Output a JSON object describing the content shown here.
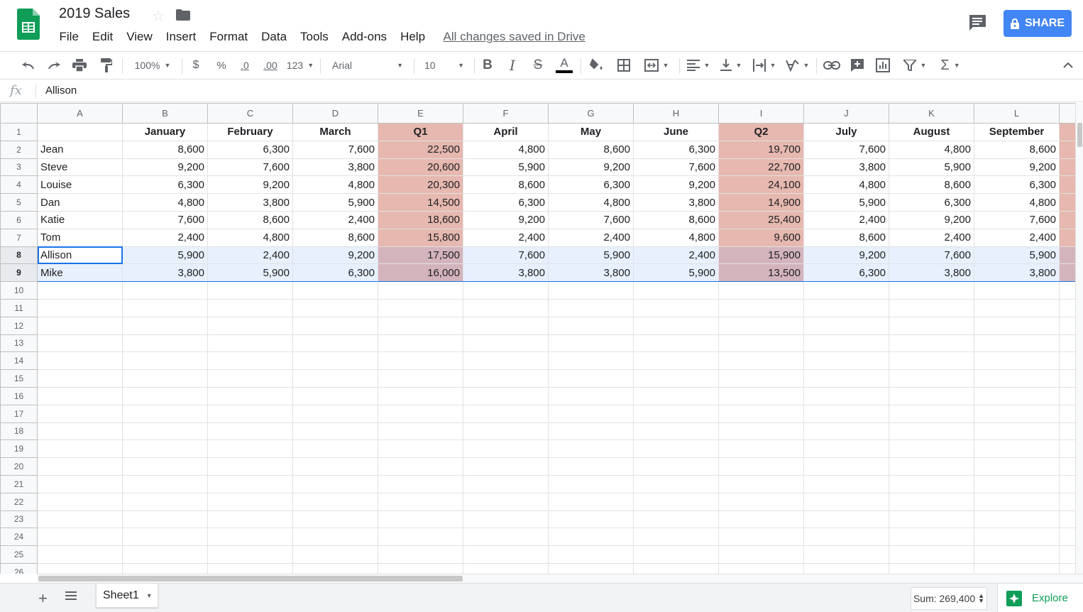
{
  "doc": {
    "title": "2019 Sales",
    "saved_status": "All changes saved in Drive",
    "share_label": "SHARE"
  },
  "menu": [
    "File",
    "Edit",
    "View",
    "Insert",
    "Format",
    "Data",
    "Tools",
    "Add-ons",
    "Help"
  ],
  "toolbar": {
    "zoom": "100%",
    "currency": "$",
    "percent": "%",
    "decrease_decimal": ".0",
    "increase_decimal": ".00",
    "more_formats": "123",
    "font": "Arial",
    "font_size": "10"
  },
  "formula_bar": {
    "fx_label": "fx",
    "value": "Allison"
  },
  "colors": {
    "accent": "#4285f4",
    "quarter_fill": "#e6b8af",
    "selection_fill": "#e8f0fe",
    "selection_border": "#1a73e8",
    "sheets_green": "#0f9d58"
  },
  "grid": {
    "columns": [
      "A",
      "B",
      "C",
      "D",
      "E",
      "F",
      "G",
      "H",
      "I",
      "J",
      "K",
      "L"
    ],
    "headers": [
      "",
      "January",
      "February",
      "March",
      "Q1",
      "April",
      "May",
      "June",
      "Q2",
      "July",
      "August",
      "September"
    ],
    "rows": [
      [
        "Jean",
        "8,600",
        "6,300",
        "7,600",
        "22,500",
        "4,800",
        "8,600",
        "6,300",
        "19,700",
        "7,600",
        "4,800",
        "8,600"
      ],
      [
        "Steve",
        "9,200",
        "7,600",
        "3,800",
        "20,600",
        "5,900",
        "9,200",
        "7,600",
        "22,700",
        "3,800",
        "5,900",
        "9,200"
      ],
      [
        "Louise",
        "6,300",
        "9,200",
        "4,800",
        "20,300",
        "8,600",
        "6,300",
        "9,200",
        "24,100",
        "4,800",
        "8,600",
        "6,300"
      ],
      [
        "Dan",
        "4,800",
        "3,800",
        "5,900",
        "14,500",
        "6,300",
        "4,800",
        "3,800",
        "14,900",
        "5,900",
        "6,300",
        "4,800"
      ],
      [
        "Katie",
        "7,600",
        "8,600",
        "2,400",
        "18,600",
        "9,200",
        "7,600",
        "8,600",
        "25,400",
        "2,400",
        "9,200",
        "7,600"
      ],
      [
        "Tom",
        "2,400",
        "4,800",
        "8,600",
        "15,800",
        "2,400",
        "2,400",
        "4,800",
        "9,600",
        "8,600",
        "2,400",
        "2,400"
      ],
      [
        "Allison",
        "5,900",
        "2,400",
        "9,200",
        "17,500",
        "7,600",
        "5,900",
        "2,400",
        "15,900",
        "9,200",
        "7,600",
        "5,900"
      ],
      [
        "Mike",
        "3,800",
        "5,900",
        "6,300",
        "16,000",
        "3,800",
        "3,800",
        "5,900",
        "13,500",
        "6,300",
        "3,800",
        "3,800"
      ]
    ],
    "row_numbers": [
      "1",
      "2",
      "3",
      "4",
      "5",
      "6",
      "7",
      "8",
      "9",
      "10",
      "11",
      "12",
      "13",
      "14",
      "15",
      "16",
      "17",
      "18",
      "19",
      "20",
      "21",
      "22",
      "23",
      "24",
      "25",
      "26"
    ],
    "quarter_columns": [
      4,
      8
    ],
    "selected_rows": [
      8,
      9
    ],
    "active_cell": "A8"
  },
  "footer": {
    "sheet_name": "Sheet1",
    "sum_label": "Sum: 269,400",
    "explore_label": "Explore"
  }
}
